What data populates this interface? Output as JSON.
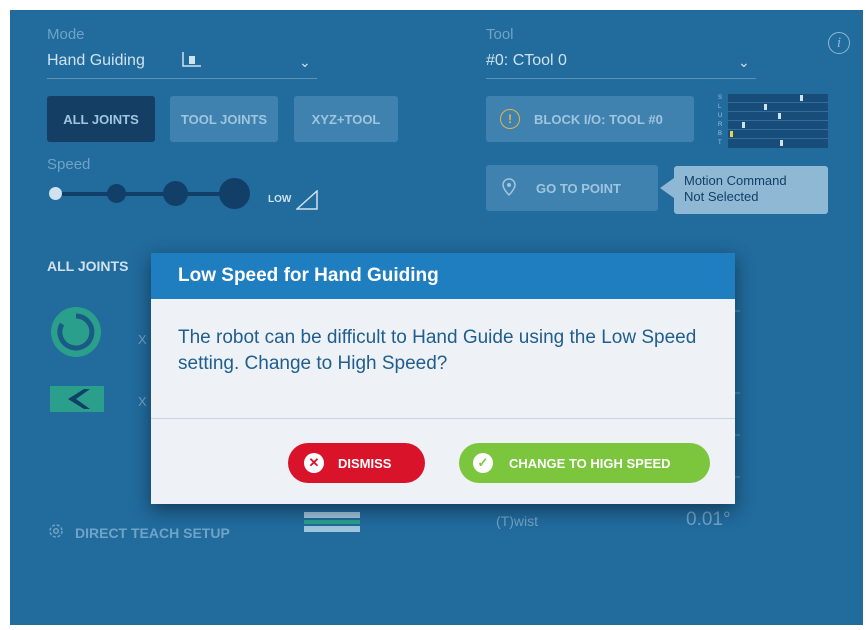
{
  "mode": {
    "label": "Mode",
    "value": "Hand Guiding"
  },
  "tool": {
    "label": "Tool",
    "value": "#0: CTool 0"
  },
  "info_glyph": "i",
  "jog_buttons": {
    "all_joints": "ALL JOINTS",
    "tool_joints": "TOOL JOINTS",
    "xyz_tool": "XYZ+TOOL"
  },
  "speed": {
    "label": "Speed",
    "level_text": "LOW"
  },
  "block_io_button": "BLOCK I/O: TOOL #0",
  "io_letters": [
    "S",
    "L",
    "U",
    "R",
    "B",
    "T"
  ],
  "go_to_point_button": "GO TO POINT",
  "motion_tooltip": {
    "line1": "Motion Command",
    "line2": "Not Selected"
  },
  "section_title": "ALL JOINTS",
  "axis_letters": [
    "X",
    "X"
  ],
  "direct_teach_button": "DIRECT TEACH SETUP",
  "twist": {
    "label": "(T)wist",
    "value": "0.01°"
  },
  "dialog": {
    "title": "Low Speed for Hand Guiding",
    "message": "The robot can be difficult to Hand Guide using the Low Speed setting. Change to High Speed?",
    "dismiss_label": "DISMISS",
    "change_label": "CHANGE TO HIGH SPEED"
  },
  "colors": {
    "background": "#216b9d",
    "dialog_header": "#1f7ec0",
    "dismiss": "#d9142a",
    "confirm": "#7cc63e"
  }
}
